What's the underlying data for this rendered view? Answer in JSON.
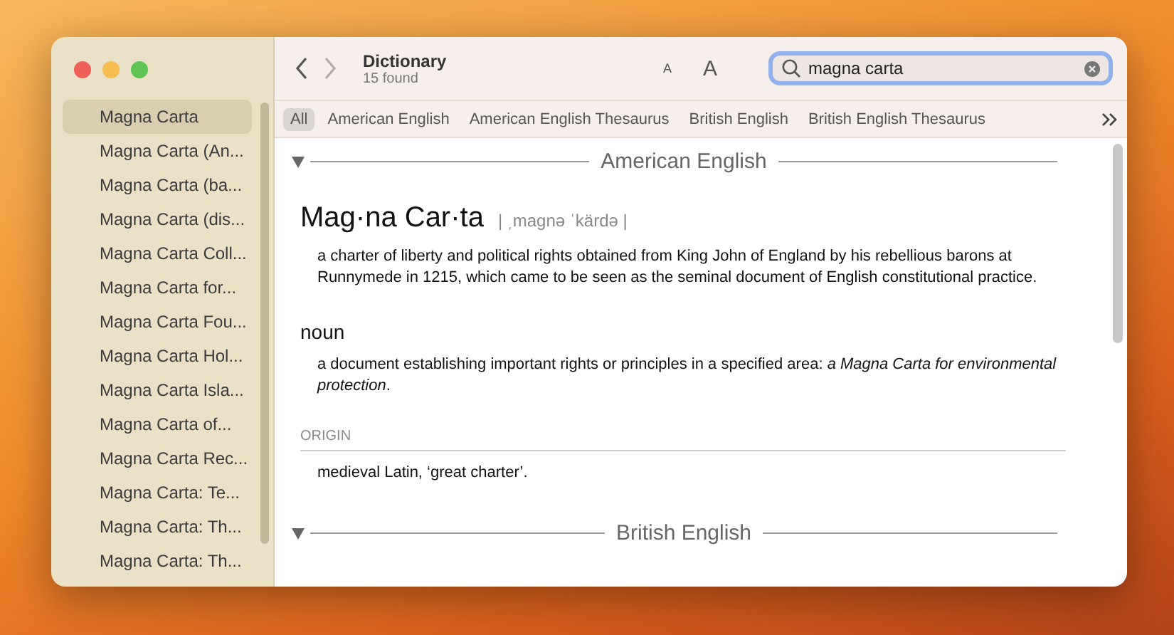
{
  "toolbar": {
    "title": "Dictionary",
    "subtitle": "15 found",
    "font_smaller": "A",
    "font_larger": "A",
    "search": {
      "value": "magna carta"
    }
  },
  "sidebar": {
    "items": [
      {
        "label": "Magna Carta",
        "selected": true
      },
      {
        "label": "Magna Carta (An...",
        "selected": false
      },
      {
        "label": "Magna Carta (ba...",
        "selected": false
      },
      {
        "label": "Magna Carta (dis...",
        "selected": false
      },
      {
        "label": "Magna Carta Coll...",
        "selected": false
      },
      {
        "label": "Magna Carta for...",
        "selected": false
      },
      {
        "label": "Magna Carta Fou...",
        "selected": false
      },
      {
        "label": "Magna Carta Hol...",
        "selected": false
      },
      {
        "label": "Magna Carta Isla...",
        "selected": false
      },
      {
        "label": "Magna Carta of...",
        "selected": false
      },
      {
        "label": "Magna Carta Rec...",
        "selected": false
      },
      {
        "label": "Magna Carta: Te...",
        "selected": false
      },
      {
        "label": "Magna Carta: Th...",
        "selected": false
      },
      {
        "label": "Magna Carta: Th...",
        "selected": false
      }
    ]
  },
  "filters": [
    {
      "label": "All",
      "selected": true
    },
    {
      "label": "American English",
      "selected": false
    },
    {
      "label": "American English Thesaurus",
      "selected": false
    },
    {
      "label": "British English",
      "selected": false
    },
    {
      "label": "British English Thesaurus",
      "selected": false
    }
  ],
  "sections": [
    {
      "heading": "American English",
      "expanded": true,
      "entry": {
        "headword": "Mag·na Car·ta",
        "pronunciation": "| ˌmaɡnə ˈkärdə |",
        "definition": "a charter of liberty and political rights obtained from King John of England by his rebellious barons at Runnymede in 1215, which came to be seen as the seminal document of English constitutional practice.",
        "part_of_speech": "noun",
        "sense": "a document establishing important rights or principles in a specified area: *a Magna Carta for environmental protection*.",
        "origin_label": "ORIGIN",
        "origin": "medieval Latin, ‘great charter’."
      }
    },
    {
      "heading": "British English",
      "expanded": true
    }
  ]
}
